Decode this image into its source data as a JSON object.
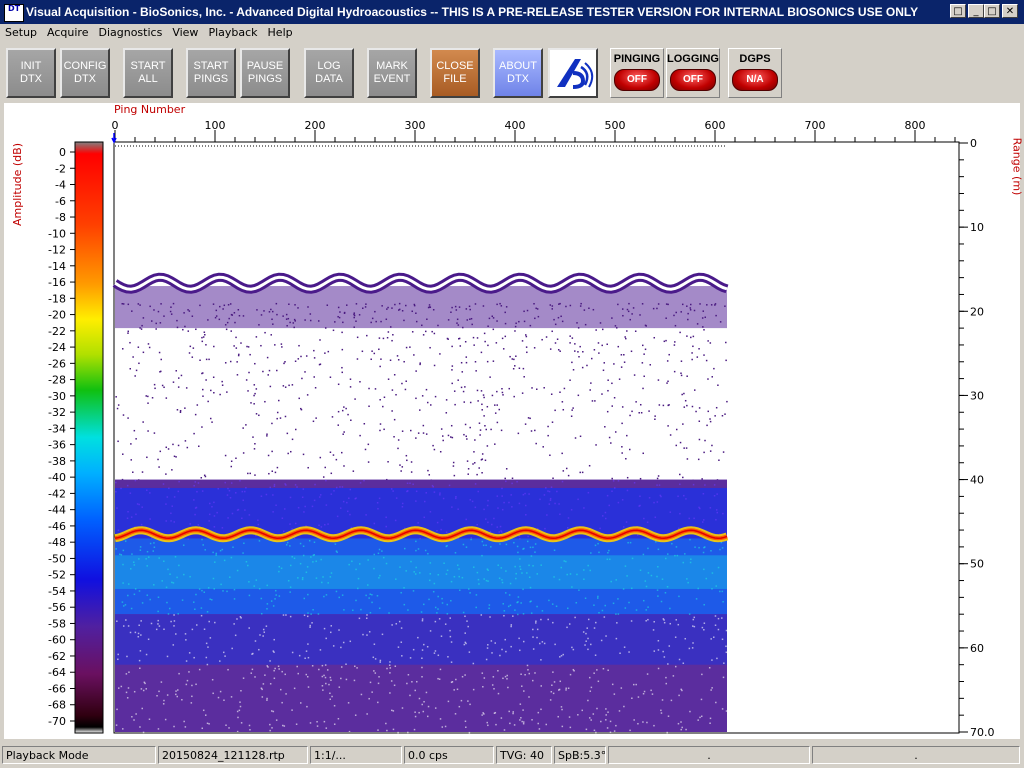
{
  "window": {
    "title": "Visual Acquisition  -  BioSonics, Inc.  -  Advanced Digital Hydroacoustics  -- THIS IS A PRE-RELEASE TESTER VERSION FOR INTERNAL BIOSONICS USE ONLY",
    "icon": "DT"
  },
  "menu": [
    "Setup",
    "Acquire",
    "Diagnostics",
    "View",
    "Playback",
    "Help"
  ],
  "toolbar": {
    "init": "INIT\nDTX",
    "config": "CONFIG\nDTX",
    "start_all": "START\nALL",
    "start_pings": "START\nPINGS",
    "pause_pings": "PAUSE\nPINGS",
    "log_data": "LOG\nDATA",
    "mark_event": "MARK\nEVENT",
    "close_file": "CLOSE\nFILE",
    "about_dtx": "ABOUT\nDTX"
  },
  "indicators": [
    {
      "label": "PINGING",
      "state": "OFF"
    },
    {
      "label": "LOGGING",
      "state": "OFF"
    },
    {
      "label": "DGPS",
      "state": "N/A"
    }
  ],
  "echogram": {
    "ping_axis_label": "Ping Number",
    "amplitude_axis_label": "Amplitude (dB)",
    "range_axis_label": "Range (m)",
    "ping_ticks": [
      "0",
      "100",
      "200",
      "300",
      "400",
      "500",
      "600",
      "700",
      "800"
    ],
    "amplitude_ticks": [
      "0",
      "-2",
      "-4",
      "-6",
      "-8",
      "-10",
      "-12",
      "-14",
      "-16",
      "-18",
      "-20",
      "-22",
      "-24",
      "-26",
      "-28",
      "-30",
      "-32",
      "-34",
      "-36",
      "-38",
      "-40",
      "-42",
      "-44",
      "-46",
      "-48",
      "-50",
      "-52",
      "-54",
      "-56",
      "-58",
      "-60",
      "-62",
      "-64",
      "-66",
      "-68",
      "-70"
    ],
    "range_ticks": [
      "0",
      "10",
      "20",
      "30",
      "40",
      "50",
      "60",
      "70.0"
    ],
    "ping_max": 850,
    "pings_recorded": 612,
    "range_max_m": 70,
    "surface_band_depth_m": [
      15,
      19
    ],
    "bottom_depth_m": 46.5,
    "colors": {
      "label": "#c00000"
    }
  },
  "status": {
    "mode": "Playback Mode",
    "file": "20150824_121128.rtp",
    "ratio": "1:1/...",
    "rate": "0.0 cps",
    "tvg": "TVG: 40",
    "spb": "SpB:5.3°",
    "f1": ".",
    "f2": "."
  }
}
